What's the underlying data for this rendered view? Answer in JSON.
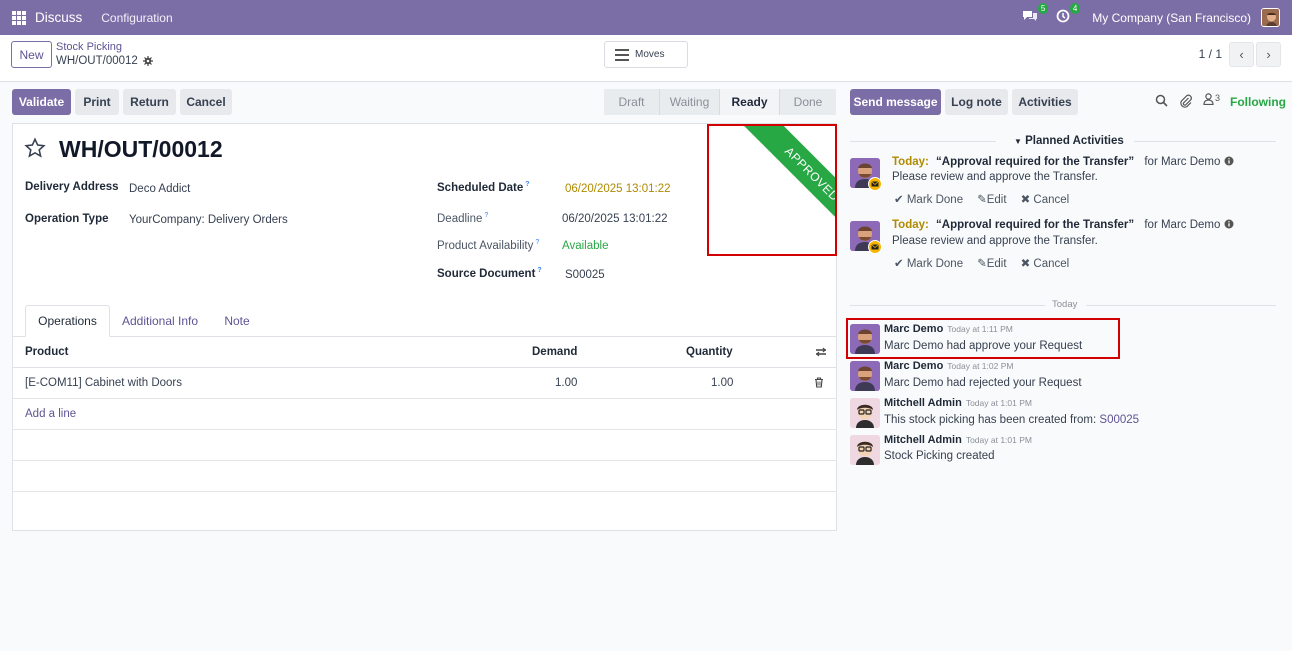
{
  "navbar": {
    "app_name": "Discuss",
    "menu": "Configuration",
    "messages_count": "5",
    "activities_count": "4",
    "company": "My Company (San Francisco)"
  },
  "control": {
    "new_label": "New",
    "breadcrumb_parent": "Stock Picking",
    "breadcrumb_current": "WH/OUT/00012",
    "moves_label": "Moves",
    "pager": "1 / 1"
  },
  "actions": {
    "validate": "Validate",
    "print": "Print",
    "return": "Return",
    "cancel": "Cancel"
  },
  "stages": [
    "Draft",
    "Waiting",
    "Ready",
    "Done"
  ],
  "active_stage": "Ready",
  "record": {
    "title": "WH/OUT/00012",
    "ribbon": "APPROVED",
    "delivery_address_label": "Delivery Address",
    "delivery_address": "Deco Addict",
    "operation_type_label": "Operation Type",
    "operation_type": "YourCompany: Delivery Orders",
    "scheduled_date_label": "Scheduled Date",
    "scheduled_date": "06/20/2025 13:01:22",
    "deadline_label": "Deadline",
    "deadline": "06/20/2025 13:01:22",
    "availability_label": "Product Availability",
    "availability": "Available",
    "source_label": "Source Document",
    "source": "S00025",
    "help_mark": "?"
  },
  "tabs": [
    "Operations",
    "Additional Info",
    "Note"
  ],
  "table": {
    "columns": [
      "Product",
      "Demand",
      "Quantity"
    ],
    "rows": [
      {
        "product": "[E-COM11] Cabinet with Doors",
        "demand": "1.00",
        "quantity": "1.00"
      }
    ],
    "add_line": "Add a line"
  },
  "chatter": {
    "send_message": "Send message",
    "log_note": "Log note",
    "activities": "Activities",
    "followers_count": "3",
    "following": "Following",
    "planned_title": "Planned Activities",
    "today_separator": "Today",
    "activities_list": [
      {
        "when": "Today:",
        "summary": "“Approval required for the Transfer”",
        "for": "for Marc Demo",
        "note": "Please review and approve the Transfer.",
        "mark_done": "Mark Done",
        "edit": "Edit",
        "cancel": "Cancel"
      },
      {
        "when": "Today:",
        "summary": "“Approval required for the Transfer”",
        "for": "for Marc Demo",
        "note": "Please review and approve the Transfer.",
        "mark_done": "Mark Done",
        "edit": "Edit",
        "cancel": "Cancel"
      }
    ],
    "messages": [
      {
        "author": "Marc Demo",
        "date": "Today at 1:11 PM",
        "body": "Marc Demo had approve your Request"
      },
      {
        "author": "Marc Demo",
        "date": "Today at 1:02 PM",
        "body": "Marc Demo had rejected your Request"
      },
      {
        "author": "Mitchell Admin",
        "date": "Today at 1:01 PM",
        "body": "This stock picking has been created from:",
        "link": "S00025"
      },
      {
        "author": "Mitchell Admin",
        "date": "Today at 1:01 PM",
        "body": "Stock Picking created"
      }
    ]
  },
  "colors": {
    "navbar": "#7b6ea6",
    "primary": "#7b6ea6",
    "ribbon": "#28a745",
    "highlight": "#d20000",
    "today": "#b08a00",
    "available": "#28a745"
  }
}
